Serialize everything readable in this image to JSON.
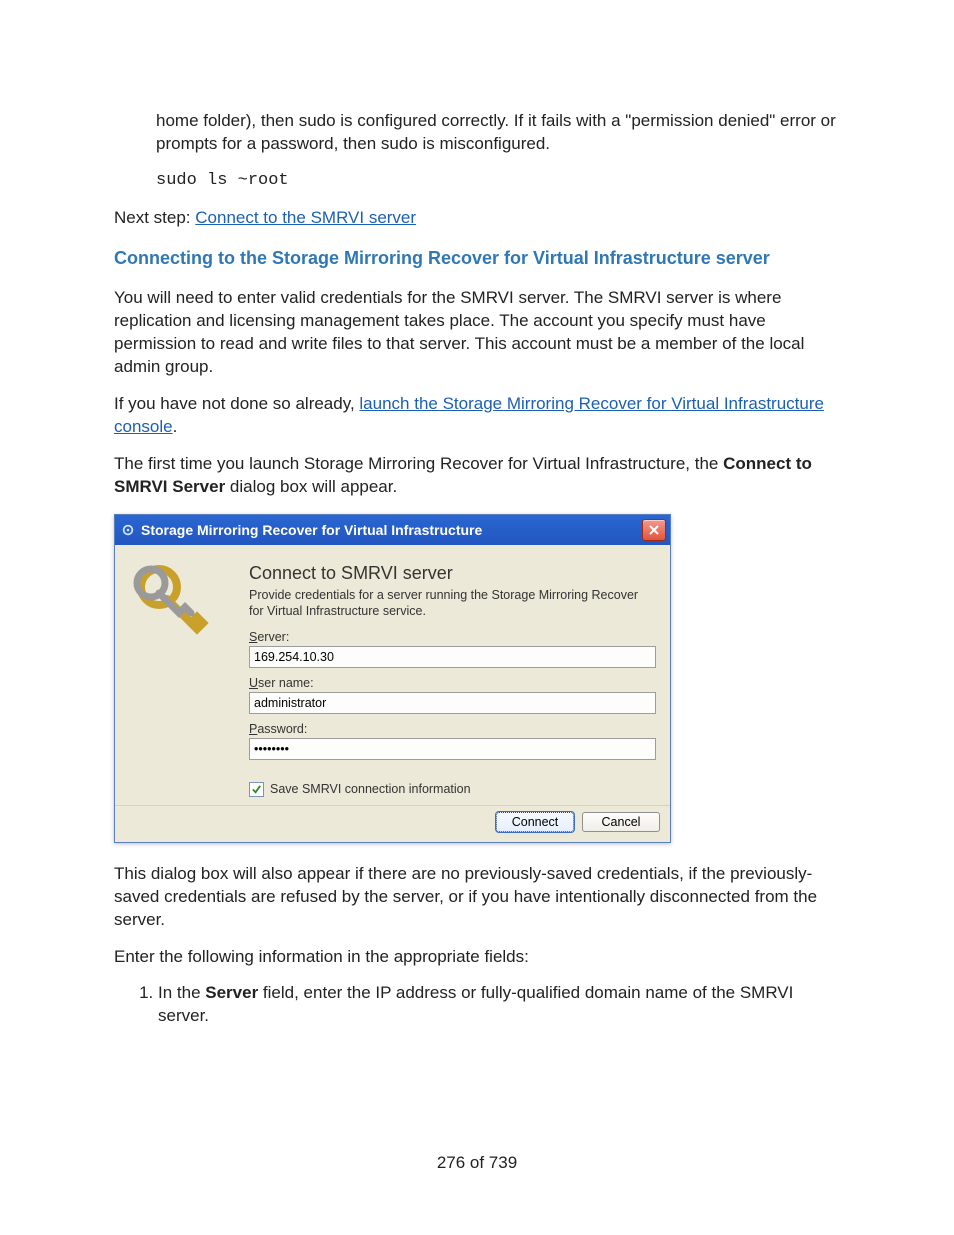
{
  "intro": {
    "para1": "home folder), then sudo is configured correctly. If it fails with a \"permission denied\" error or prompts for a password, then sudo is misconfigured.",
    "code": "sudo ls ~root",
    "next_step_prefix": "Next step: ",
    "next_step_link": "Connect to the SMRVI server"
  },
  "section": {
    "title": "Connecting to the Storage Mirroring Recover for Virtual Infrastructure server",
    "para1": "You will need to enter valid credentials for the SMRVI server. The SMRVI server is where replication and licensing management takes place. The account you specify must have permission to read and write files to that server. This account must be a member of the local admin group.",
    "para2_prefix": "If you have not done so already, ",
    "para2_link": "launch the Storage Mirroring Recover for Virtual Infrastructure console",
    "para2_suffix": ".",
    "para3_a": "The first time you launch Storage Mirroring Recover for Virtual Infrastructure, the ",
    "para3_bold": "Connect to SMRVI Server",
    "para3_b": " dialog box will appear."
  },
  "dialog": {
    "titlebar": "Storage Mirroring Recover for Virtual Infrastructure",
    "heading": "Connect to SMRVI server",
    "description": "Provide credentials for a server running the Storage Mirroring Recover for Virtual Infrastructure service.",
    "server_label_u": "S",
    "server_label_rest": "erver:",
    "server_value": "169.254.10.30",
    "user_label_u": "U",
    "user_label_rest": "ser name:",
    "user_value": "administrator",
    "pass_label_u": "P",
    "pass_label_rest": "assword:",
    "pass_value": "••••••••",
    "checkbox_label_pre": "S",
    "checkbox_label_u": "a",
    "checkbox_label_rest": "ve SMRVI connection information",
    "connect_btn_u": "C",
    "connect_btn_rest": "onnect",
    "cancel_btn": "Cancel"
  },
  "after": {
    "para1": "This dialog box will also appear if there are no previously-saved credentials, if the previously-saved credentials are refused by the server, or if you have intentionally disconnected from the server.",
    "para2": "Enter the following information in the appropriate fields:",
    "li1_a": "In the ",
    "li1_bold": "Server",
    "li1_b": " field, enter the IP address or fully-qualified domain name of the SMRVI server."
  },
  "page_number": "276 of 739"
}
